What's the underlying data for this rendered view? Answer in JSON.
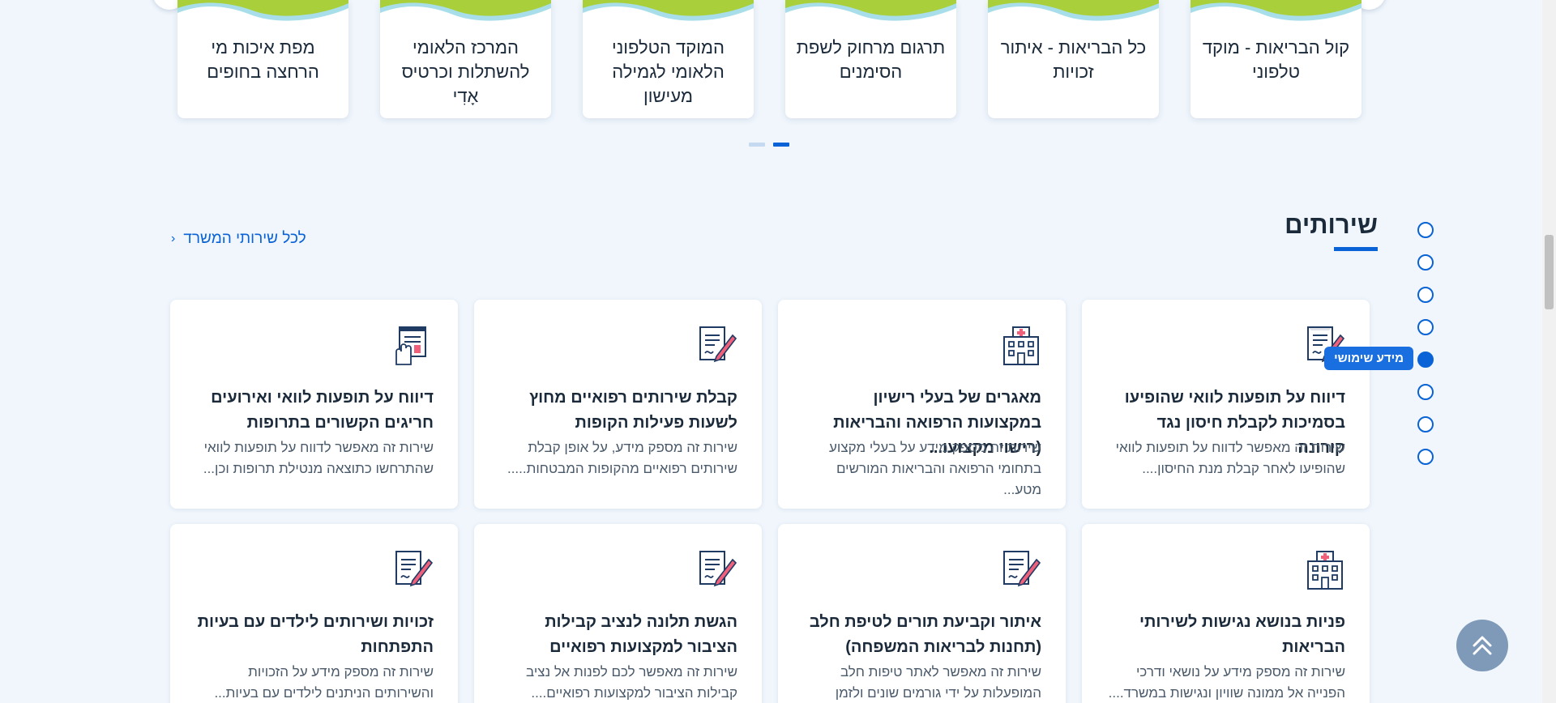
{
  "carousel": {
    "cards": [
      {
        "title": "קול הבריאות - מוקד טלפוני"
      },
      {
        "title": "כל הבריאות - איתור זכויות"
      },
      {
        "title": "תרגום מרחוק לשפת הסימנים"
      },
      {
        "title": "המוקד הטלפוני הלאומי לגמילה מעישון"
      },
      {
        "title": "המרכז הלאומי להשתלות וכרטיס אָדִי"
      },
      {
        "title": "מפת איכות מי הרחצה בחופים"
      }
    ],
    "page_count": 2,
    "active_page": 2
  },
  "section": {
    "title": "שירותים",
    "all_link": "לכל שירותי המשרד"
  },
  "services": [
    {
      "icon": "form-pen-icon",
      "title": "דיווח על תופעות לוואי שהופיעו בסמיכות לקבלת חיסון נגד קורונה",
      "desc": "שירות זה מאפשר לדווח על תופעות לוואי שהופיעו לאחר קבלת מנת החיסון...."
    },
    {
      "icon": "hospital-icon",
      "title": "מאגרים של בעלי רישיון במקצועות הרפואה והבריאות (רישוי מקצועו...",
      "desc": "שירות זה מספק מידע על בעלי מקצוע בתחומי הרפואה והבריאות המורשים מטע..."
    },
    {
      "icon": "form-pen-icon",
      "title": "קבלת שירותים רפואיים מחוץ לשעות פעילות הקופות",
      "desc": "שירות זה מספק מידע, על אופן קבלת שירותים רפואיים מהקופות המבטחות....."
    },
    {
      "icon": "document-hand-icon",
      "title": "דיווח על תופעות לוואי ואירועים חריגים הקשורים בתרופות",
      "desc": "שירות זה מאפשר לדווח על תופעות לוואי שהתרחשו כתוצאה מנטילת תרופות וכן..."
    },
    {
      "icon": "hospital-icon",
      "title": "פניות בנושא נגישות לשירותי הבריאות",
      "desc": "שירות זה מספק מידע על נושאי ודרכי הפנייה אל ממונה שוויון ונגישות במשרד...."
    },
    {
      "icon": "form-pen-icon",
      "title": "איתור וקביעת תורים לטיפת חלב (תחנות לבריאות המשפחה)",
      "desc": "שירות זה מאפשר לאתר טיפות חלב המופעלות על ידי גורמים שונים ולזמן תור..."
    },
    {
      "icon": "form-pen-icon",
      "title": "הגשת תלונה לנציב קבילות הציבור למקצועות רפואיים",
      "desc": "שירות זה מאפשר לכם לפנות אל נציב קבילות הציבור למקצועות רפואיים...."
    },
    {
      "icon": "form-pen-icon",
      "title": "זכויות ושירותים לילדים עם בעיות התפתחות",
      "desc": "שירות זה מספק מידע על הזכויות והשירותים הניתנים לילדים עם בעיות..."
    }
  ],
  "side_nav": {
    "count": 8,
    "active_index": 4,
    "active_label": "מידע שימושי"
  },
  "colors": {
    "accent": "#0a63d6",
    "wave_green": "#a9cf3a",
    "wave_teal": "#5ec3d8",
    "icon_navy": "#1f3b64",
    "icon_pink": "#f0607a"
  }
}
